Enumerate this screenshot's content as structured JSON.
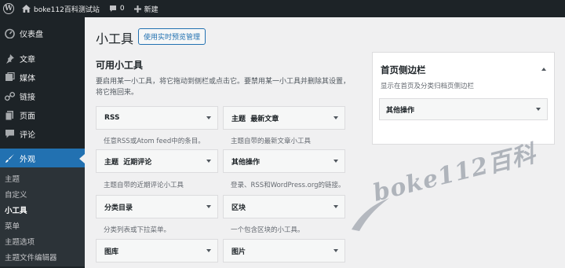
{
  "adminbar": {
    "site_name": "boke112百科测试站",
    "comments_count": "0",
    "new_label": "新建"
  },
  "sidebar": {
    "items": [
      {
        "label": "仪表盘",
        "icon": "dashboard-icon"
      },
      {
        "label": "文章",
        "icon": "pin-icon"
      },
      {
        "label": "媒体",
        "icon": "media-icon"
      },
      {
        "label": "链接",
        "icon": "link-icon"
      },
      {
        "label": "页面",
        "icon": "page-icon"
      },
      {
        "label": "评论",
        "icon": "comment-icon"
      },
      {
        "label": "外观",
        "icon": "brush-icon"
      }
    ],
    "submenu": [
      "主题",
      "自定义",
      "小工具",
      "菜单",
      "主题选项",
      "主题文件编辑器"
    ],
    "active_submenu": "小工具"
  },
  "main": {
    "title": "小工具",
    "preview_button": "使用实时预览管理",
    "available_title": "可用小工具",
    "available_desc": "要启用某一小工具，将它拖动到侧栏或点击它。要禁用某一小工具并删除其设置，将它拖回来。",
    "widgets": [
      {
        "name": "RSS",
        "desc": "任意RSS或Atom feed中的条目。"
      },
      {
        "name": "主题  最新文章",
        "desc": "主题自带的最新文章小工具"
      },
      {
        "name": "主题  近期评论",
        "desc": "主题自带的近期评论小工具"
      },
      {
        "name": "其他操作",
        "desc": "登录、RSS和WordPress.org的链接。"
      },
      {
        "name": "分类目录",
        "desc": "分类列表或下拉菜单。"
      },
      {
        "name": "区块",
        "desc": "一个包含区块的小工具。"
      },
      {
        "name": "图库",
        "desc": ""
      },
      {
        "name": "图片",
        "desc": ""
      }
    ]
  },
  "sidebar_area": {
    "title": "首页侧边栏",
    "desc": "显示在首页及分类归档页侧边栏",
    "widget": "其他操作"
  },
  "watermark": "boke112百科",
  "colors": {
    "adminbar": "#1d2327",
    "accent": "#2271b1",
    "background": "#f0f0f1"
  }
}
